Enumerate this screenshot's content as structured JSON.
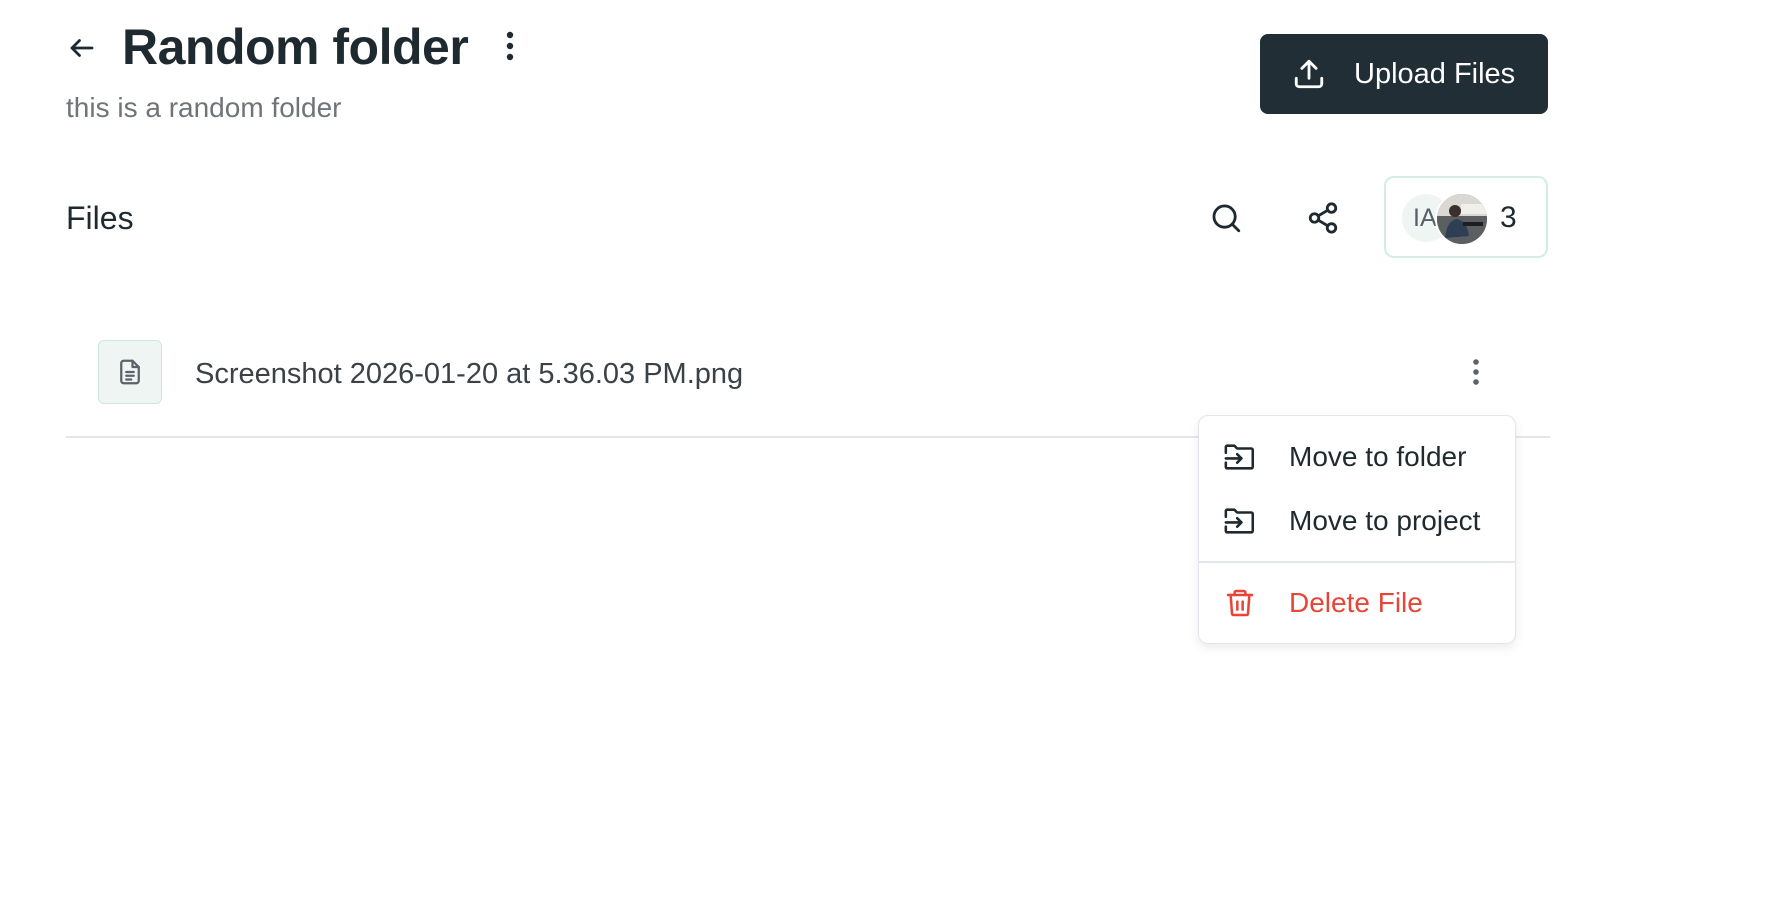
{
  "header": {
    "title": "Random folder",
    "description": "this is a random folder",
    "upload_label": "Upload Files"
  },
  "files_section": {
    "heading": "Files",
    "members": {
      "initials": "IA",
      "count": "3"
    }
  },
  "files": [
    {
      "name": "Screenshot 2026-01-20 at 5.36.03 PM.png"
    }
  ],
  "context_menu": {
    "items": [
      {
        "label": "Move to folder",
        "icon": "move-to-folder-icon"
      },
      {
        "label": "Move to project",
        "icon": "move-to-folder-icon"
      },
      {
        "label": "Delete File",
        "icon": "trash-icon",
        "color": "#e84538"
      }
    ]
  },
  "colors": {
    "primary_button": "#212e35",
    "danger": "#e84538",
    "accent_tint": "#eef5f3"
  }
}
